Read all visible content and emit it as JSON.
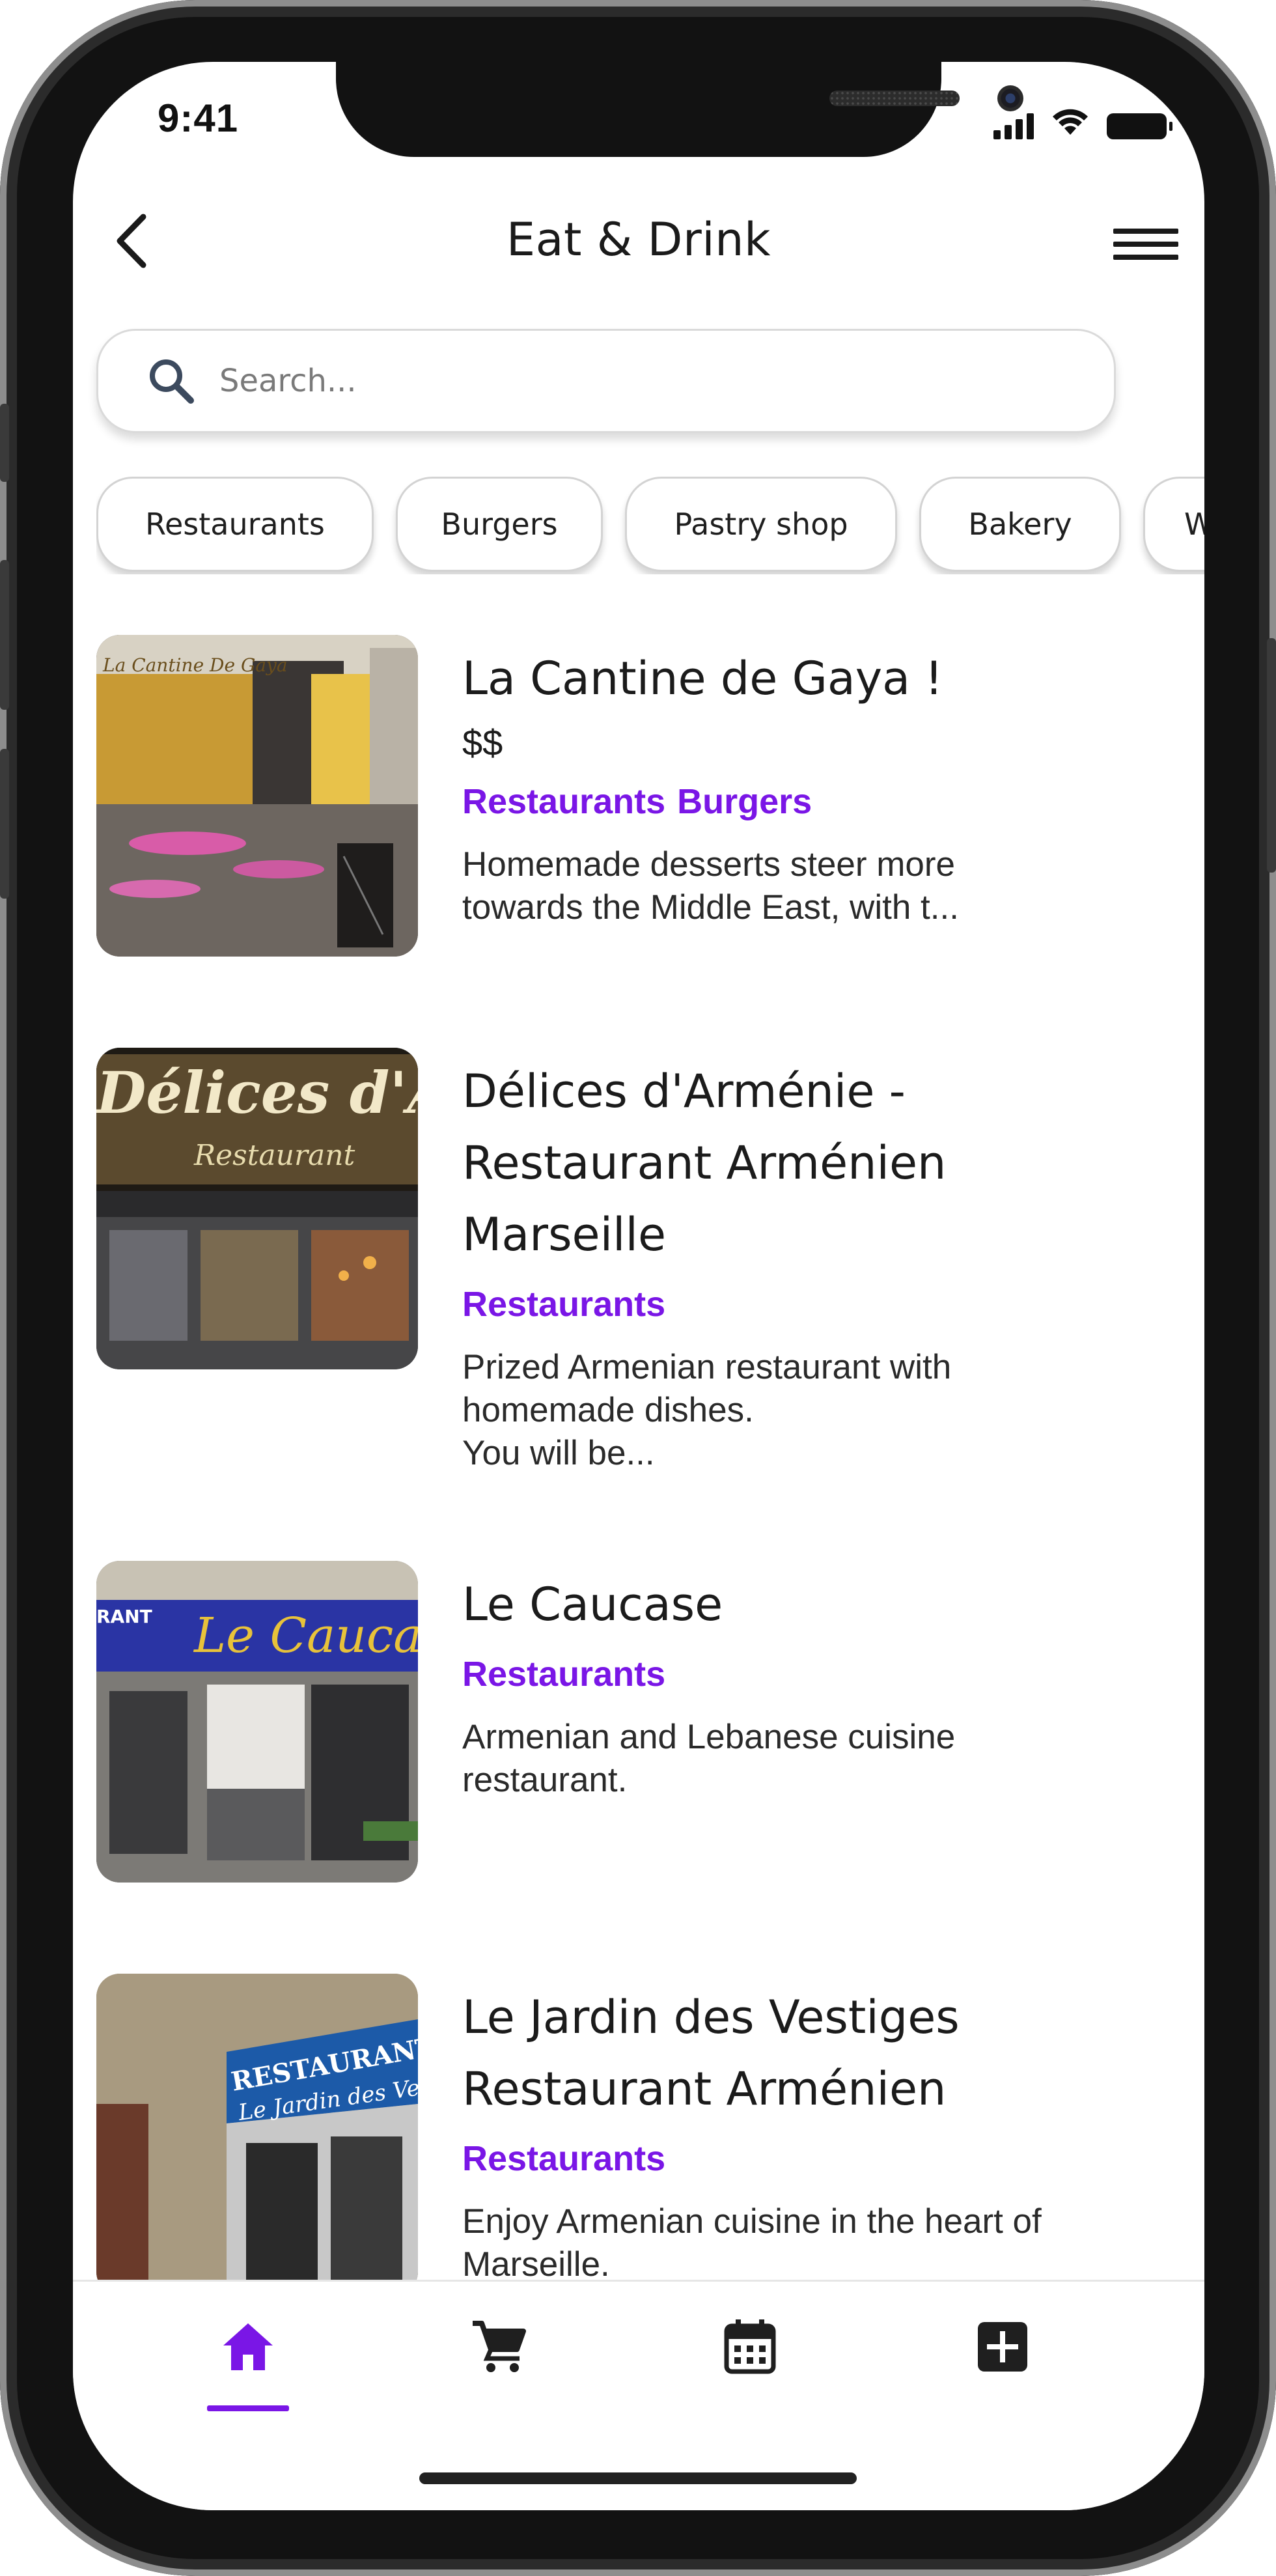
{
  "status": {
    "time": "9:41"
  },
  "header": {
    "title": "Eat & Drink"
  },
  "search": {
    "placeholder": "Search..."
  },
  "chips": [
    {
      "label": "Restaurants"
    },
    {
      "label": "Burgers"
    },
    {
      "label": "Pastry shop"
    },
    {
      "label": "Bakery"
    },
    {
      "label": "W"
    }
  ],
  "items": [
    {
      "title": "La Cantine de Gaya !",
      "price": "$$",
      "categories": [
        "Restaurants",
        "Burgers"
      ],
      "description": "Homemade desserts steer more\ntowards the Middle East, with t..."
    },
    {
      "title": "Délices d'Arménie -\nRestaurant Arménien\nMarseille",
      "categories": [
        "Restaurants"
      ],
      "description": "Prized Armenian restaurant with\nhomemade dishes.\nYou will be..."
    },
    {
      "title": "Le Caucase",
      "categories": [
        "Restaurants"
      ],
      "description": "Armenian and Lebanese cuisine\nrestaurant."
    },
    {
      "title": "Le Jardin des Vestiges\nRestaurant Arménien",
      "categories": [
        "Restaurants"
      ],
      "description": "Enjoy Armenian cuisine in the heart of\nMarseille."
    }
  ],
  "photo_text": {
    "item1": "La Cantine De Gaya",
    "item2_sign": "Délices d'Arm",
    "item2_sub": "Restaurant",
    "item3_sign": "Le Caucas",
    "item3_small": "RANT",
    "item4_sign": "RESTAURANT ARME",
    "item4_sub": "Le Jardin des Vestig"
  },
  "nav": {
    "items": [
      {
        "icon": "home-icon",
        "active": true
      },
      {
        "icon": "cart-icon",
        "active": false
      },
      {
        "icon": "calendar-icon",
        "active": false
      },
      {
        "icon": "add-icon",
        "active": false
      }
    ]
  },
  "colors": {
    "accent": "#7a16e6",
    "frame": "#121212",
    "text": "#1b1b1b"
  }
}
